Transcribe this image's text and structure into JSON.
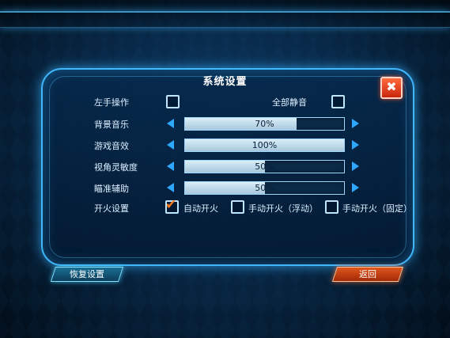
{
  "dialog": {
    "title": "系统设置",
    "close_icon": "close-icon",
    "colors": {
      "accent": "#3fb8ff",
      "close": "#e03b12",
      "check": "#ff7a1c"
    }
  },
  "toggles": {
    "left_hand_label": "左手操作",
    "left_hand_checked": false,
    "mute_all_label": "全部静音",
    "mute_all_checked": false
  },
  "sliders": [
    {
      "label": "背景音乐",
      "value_text": "70%",
      "value": 0.7
    },
    {
      "label": "游戏音效",
      "value_text": "100%",
      "value": 1.0
    },
    {
      "label": "视角灵敏度",
      "value_text": "50%",
      "value": 0.5
    },
    {
      "label": "瞄准辅助",
      "value_text": "50%",
      "value": 0.5
    }
  ],
  "fire_mode": {
    "label": "开火设置",
    "options": [
      {
        "label": "自动开火",
        "checked": true
      },
      {
        "label": "手动开火（浮动）",
        "checked": false
      },
      {
        "label": "手动开火（固定）",
        "checked": false
      }
    ]
  },
  "footer": {
    "reset_label": "恢复设置",
    "back_label": "返回"
  }
}
